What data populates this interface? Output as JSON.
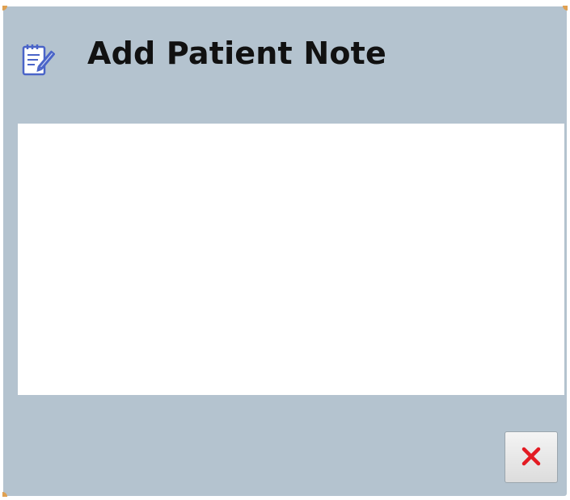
{
  "dialog": {
    "title": "Add Patient Note",
    "icon": "note-edit-icon",
    "note": {
      "value": "",
      "placeholder": ""
    },
    "close_button": {
      "icon": "close-icon",
      "accent_color": "#e31b23"
    }
  },
  "colors": {
    "dialog_background": "#b4c3cf",
    "icon_color": "#4a64c8",
    "title_color": "#111111"
  }
}
